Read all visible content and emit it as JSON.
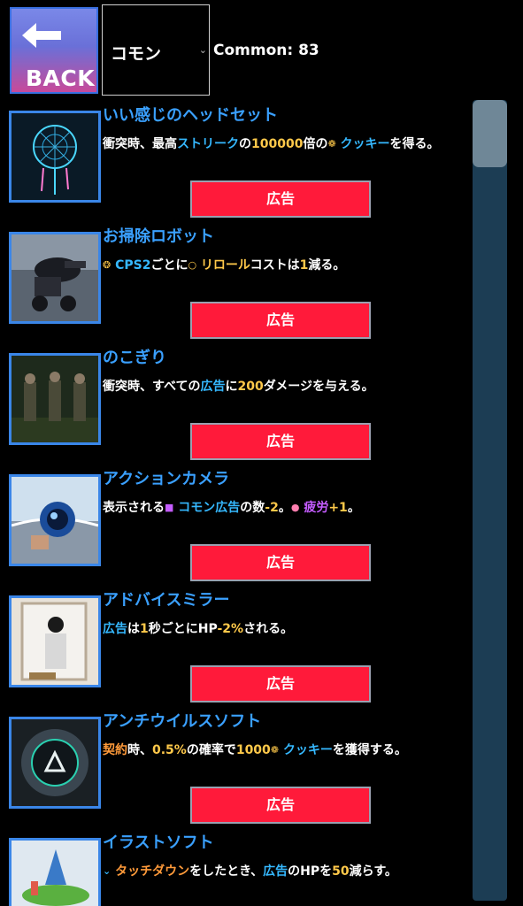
{
  "header": {
    "back_label": "BACK",
    "rarity_value": "コモン",
    "count_text": "Common: 83"
  },
  "items": [
    {
      "title": "いい感じのヘッドセット",
      "desc": [
        {
          "t": "衝突時、最高"
        },
        {
          "t": "ストリーク",
          "c": "hl-blue"
        },
        {
          "t": "の"
        },
        {
          "t": "100000",
          "c": "hl-gold"
        },
        {
          "t": "倍の"
        },
        {
          "t": "❁",
          "c": "hl-gold ico"
        },
        {
          "t": " クッキー",
          "c": "hl-blue"
        },
        {
          "t": "を得る。"
        }
      ],
      "button": "広告",
      "image": "dreamcatcher-image"
    },
    {
      "title": "お掃除ロボット",
      "desc": [
        {
          "t": "❂",
          "c": "hl-gold ico"
        },
        {
          "t": " CPS2",
          "c": "hl-blue"
        },
        {
          "t": "ごとに"
        },
        {
          "t": "○",
          "c": "hl-gold ico"
        },
        {
          "t": " リロール",
          "c": "hl-gold"
        },
        {
          "t": "コストは"
        },
        {
          "t": "1",
          "c": "hl-gold"
        },
        {
          "t": "減る。"
        }
      ],
      "button": "広告",
      "image": "robot-image"
    },
    {
      "title": "のこぎり",
      "desc": [
        {
          "t": "衝突時、すべての"
        },
        {
          "t": "広告",
          "c": "hl-blue"
        },
        {
          "t": "に"
        },
        {
          "t": "200",
          "c": "hl-gold"
        },
        {
          "t": "ダメージを与える。"
        }
      ],
      "button": "広告",
      "image": "soldiers-image"
    },
    {
      "title": "アクションカメラ",
      "desc": [
        {
          "t": "表示される"
        },
        {
          "t": "■",
          "c": "hl-purple ico"
        },
        {
          "t": " コモン広告",
          "c": "hl-blue"
        },
        {
          "t": "の数"
        },
        {
          "t": "-2",
          "c": "hl-gold"
        },
        {
          "t": "。"
        },
        {
          "t": "●",
          "c": "hl-pink ico"
        },
        {
          "t": " 疲労",
          "c": "hl-purple"
        },
        {
          "t": "+1",
          "c": "hl-gold"
        },
        {
          "t": "。"
        }
      ],
      "button": "広告",
      "image": "camera-image"
    },
    {
      "title": "アドバイスミラー",
      "desc": [
        {
          "t": "広告",
          "c": "hl-blue"
        },
        {
          "t": "は"
        },
        {
          "t": "1",
          "c": "hl-gold"
        },
        {
          "t": "秒ごとにHP"
        },
        {
          "t": "-2%",
          "c": "hl-gold"
        },
        {
          "t": "される。"
        }
      ],
      "button": "広告",
      "image": "mirror-image"
    },
    {
      "title": "アンチウイルスソフト",
      "desc": [
        {
          "t": "契約",
          "c": "hl-orange"
        },
        {
          "t": "時、"
        },
        {
          "t": "0.5%",
          "c": "hl-gold"
        },
        {
          "t": "の確率で"
        },
        {
          "t": "1000",
          "c": "hl-gold"
        },
        {
          "t": "❁",
          "c": "hl-gold ico"
        },
        {
          "t": " クッキー",
          "c": "hl-blue"
        },
        {
          "t": "を獲得する。"
        }
      ],
      "button": "広告",
      "image": "antivirus-image"
    },
    {
      "title": "イラストソフト",
      "desc": [
        {
          "t": "⌄",
          "c": "hl-blue ico"
        },
        {
          "t": " タッチダウン",
          "c": "hl-orange"
        },
        {
          "t": "をしたとき、"
        },
        {
          "t": "広告",
          "c": "hl-blue"
        },
        {
          "t": "のHPを"
        },
        {
          "t": "50",
          "c": "hl-gold"
        },
        {
          "t": "減らす。"
        }
      ],
      "button": "",
      "image": "island-image"
    }
  ],
  "colors": {
    "accent_title": "#3aa0ff",
    "ad_button": "#ff1a3a",
    "highlight_blue": "#35b8ff",
    "highlight_gold": "#ffc94a"
  }
}
